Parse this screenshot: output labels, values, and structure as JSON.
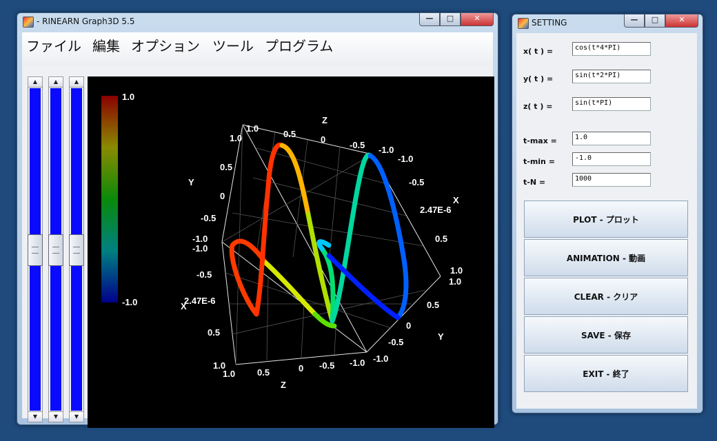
{
  "main": {
    "title": "- RINEARN Graph3D 5.5",
    "menu": [
      "ファイル",
      "編集",
      "オプション",
      "ツール",
      "プログラム"
    ],
    "sliders": [
      {
        "level": 0.5
      },
      {
        "level": 0.5
      },
      {
        "level": 0.5
      }
    ]
  },
  "colorbar": {
    "max": "1.0",
    "min": "-1.0"
  },
  "plot_labels": {
    "z_axis": "Z",
    "y_axis": "Y",
    "x_axis": "X",
    "ticks_1": "1.0",
    "ticks_05": "0.5",
    "ticks_0": "0",
    "ticks_m05": "-0.5",
    "ticks_m1": "-1.0",
    "ticks_e": "2.47E-6"
  },
  "setting": {
    "title": "SETTING",
    "x_label": "x( t ) =",
    "x_value": "cos(t*4*PI)",
    "y_label": "y( t ) =",
    "y_value": "sin(t*2*PI)",
    "z_label": "z( t ) =",
    "z_value": "sin(t*PI)",
    "tmax_label": "t-max =",
    "tmax_value": "1.0",
    "tmin_label": "t-min =",
    "tmin_value": "-1.0",
    "tn_label": "t-N =",
    "tn_value": "1000",
    "buttons": [
      "PLOT - プロット",
      "ANIMATION - 動画",
      "CLEAR - クリア",
      "SAVE - 保存",
      "EXIT - 終了"
    ]
  },
  "colors": {
    "curve_high": "#d20000",
    "curve_low": "#0010ff",
    "background": "#000000"
  },
  "icons": {
    "minimize": "minimize-icon",
    "maximize": "maximize-icon",
    "close": "close-icon"
  }
}
